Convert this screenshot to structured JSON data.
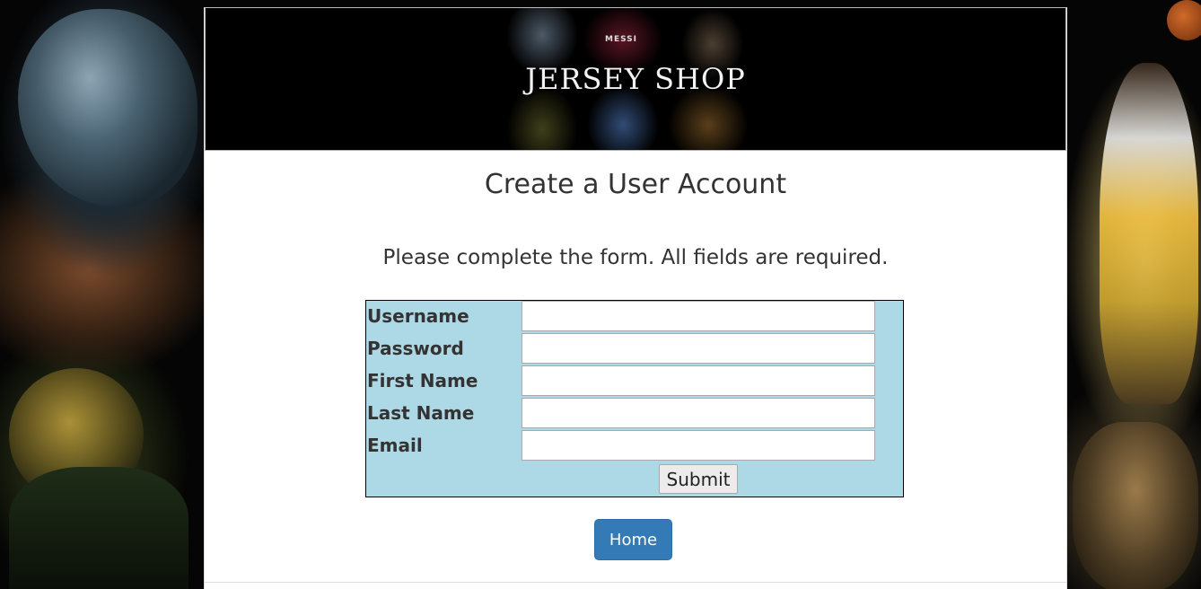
{
  "header": {
    "site_title": "JERSEY SHOP",
    "banner_jersey_text": "MESSI"
  },
  "page": {
    "title": "Create a User Account",
    "instructions": "Please complete the form. All fields are required."
  },
  "form": {
    "fields": [
      {
        "label": "Username",
        "value": ""
      },
      {
        "label": "Password",
        "value": ""
      },
      {
        "label": "First Name",
        "value": ""
      },
      {
        "label": "Last Name",
        "value": ""
      },
      {
        "label": "Email",
        "value": ""
      }
    ],
    "submit_label": "Submit"
  },
  "nav": {
    "home_label": "Home"
  },
  "colors": {
    "form_background": "#add8e6",
    "home_button": "#337ab7",
    "banner_background": "#000000"
  }
}
